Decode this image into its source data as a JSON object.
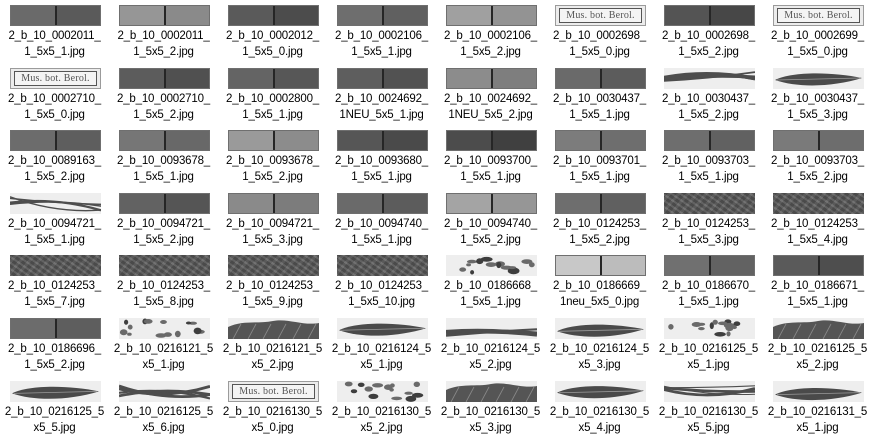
{
  "files": [
    {
      "line1": "2_b_10_0002011_",
      "line2": "1_5x5_1.jpg",
      "thumb": "bar",
      "left": "#6a6a6a",
      "right": "#5a5a5a"
    },
    {
      "line1": "2_b_10_0002011_",
      "line2": "1_5x5_2.jpg",
      "thumb": "bar",
      "left": "#969696",
      "right": "#8a8a8a"
    },
    {
      "line1": "2_b_10_0002012_",
      "line2": "1_5x5_0.jpg",
      "thumb": "bar",
      "left": "#5a5a5a",
      "right": "#4c4c4c"
    },
    {
      "line1": "2_b_10_0002106_",
      "line2": "1_5x5_1.jpg",
      "thumb": "bar",
      "left": "#6e6e6e",
      "right": "#606060"
    },
    {
      "line1": "2_b_10_0002106_",
      "line2": "1_5x5_2.jpg",
      "thumb": "bar",
      "left": "#a0a0a0",
      "right": "#939393"
    },
    {
      "line1": "2_b_10_0002698_",
      "line2": "1_5x5_0.jpg",
      "thumb": "label",
      "label_text": "Mus. bot. Berol."
    },
    {
      "line1": "2_b_10_0002698_",
      "line2": "1_5x5_2.jpg",
      "thumb": "bar",
      "left": "#545454",
      "right": "#474747"
    },
    {
      "line1": "2_b_10_0002699_",
      "line2": "1_5x5_0.jpg",
      "thumb": "label",
      "label_text": "Mus. bot. Berol."
    },
    {
      "line1": "2_b_10_0002710_",
      "line2": "1_5x5_0.jpg",
      "thumb": "label",
      "label_text": "Mus. bot. Berol."
    },
    {
      "line1": "2_b_10_0002710_",
      "line2": "1_5x5_2.jpg",
      "thumb": "bar",
      "left": "#5c5c5c",
      "right": "#505050"
    },
    {
      "line1": "2_b_10_0002800_",
      "line2": "1_5x5_1.jpg",
      "thumb": "bar",
      "left": "#646464",
      "right": "#575757"
    },
    {
      "line1": "2_b_10_0024692_",
      "line2": "1NEU_5x5_1.jpg",
      "thumb": "bar",
      "left": "#5e5e5e",
      "right": "#525252"
    },
    {
      "line1": "2_b_10_0024692_",
      "line2": "1NEU_5x5_2.jpg",
      "thumb": "bar",
      "left": "#8c8c8c",
      "right": "#7e7e7e"
    },
    {
      "line1": "2_b_10_0030437_",
      "line2": "1_5x5_1.jpg",
      "thumb": "bar",
      "left": "#6a6a6a",
      "right": "#5c5c5c"
    },
    {
      "line1": "2_b_10_0030437_",
      "line2": "1_5x5_2.jpg",
      "thumb": "plant"
    },
    {
      "line1": "2_b_10_0030437_",
      "line2": "1_5x5_3.jpg",
      "thumb": "plant"
    },
    {
      "line1": "2_b_10_0089163_",
      "line2": "1_5x5_2.jpg",
      "thumb": "bar",
      "left": "#6c6c6c",
      "right": "#5e5e5e"
    },
    {
      "line1": "2_b_10_0093678_",
      "line2": "1_5x5_1.jpg",
      "thumb": "bar",
      "left": "#767676",
      "right": "#686868"
    },
    {
      "line1": "2_b_10_0093678_",
      "line2": "1_5x5_2.jpg",
      "thumb": "bar",
      "left": "#9a9a9a",
      "right": "#8c8c8c"
    },
    {
      "line1": "2_b_10_0093680_",
      "line2": "1_5x5_1.jpg",
      "thumb": "bar",
      "left": "#565656",
      "right": "#4a4a4a"
    },
    {
      "line1": "2_b_10_0093700_",
      "line2": "1_5x5_1.jpg",
      "thumb": "bar",
      "left": "#4c4c4c",
      "right": "#404040"
    },
    {
      "line1": "2_b_10_0093701_",
      "line2": "1_5x5_1.jpg",
      "thumb": "bar",
      "left": "#7c7c7c",
      "right": "#6e6e6e"
    },
    {
      "line1": "2_b_10_0093703_",
      "line2": "1_5x5_1.jpg",
      "thumb": "bar",
      "left": "#6e6e6e",
      "right": "#616161"
    },
    {
      "line1": "2_b_10_0093703_",
      "line2": "1_5x5_2.jpg",
      "thumb": "bar",
      "left": "#7a7a7a",
      "right": "#6d6d6d"
    },
    {
      "line1": "2_b_10_0094721_",
      "line2": "1_5x5_1.jpg",
      "thumb": "plant"
    },
    {
      "line1": "2_b_10_0094721_",
      "line2": "1_5x5_2.jpg",
      "thumb": "bar",
      "left": "#626262",
      "right": "#555555"
    },
    {
      "line1": "2_b_10_0094721_",
      "line2": "1_5x5_3.jpg",
      "thumb": "bar",
      "left": "#8a8a8a",
      "right": "#7c7c7c"
    },
    {
      "line1": "2_b_10_0094740_",
      "line2": "1_5x5_1.jpg",
      "thumb": "bar",
      "left": "#6a6a6a",
      "right": "#5c5c5c"
    },
    {
      "line1": "2_b_10_0094740_",
      "line2": "1_5x5_2.jpg",
      "thumb": "bar",
      "left": "#a4a4a4",
      "right": "#969696"
    },
    {
      "line1": "2_b_10_0124253_",
      "line2": "1_5x5_2.jpg",
      "thumb": "bar",
      "left": "#6e6e6e",
      "right": "#606060"
    },
    {
      "line1": "2_b_10_0124253_",
      "line2": "1_5x5_3.jpg",
      "thumb": "texture"
    },
    {
      "line1": "2_b_10_0124253_",
      "line2": "1_5x5_4.jpg",
      "thumb": "texture"
    },
    {
      "line1": "2_b_10_0124253_",
      "line2": "1_5x5_7.jpg",
      "thumb": "texture"
    },
    {
      "line1": "2_b_10_0124253_",
      "line2": "1_5x5_8.jpg",
      "thumb": "texture"
    },
    {
      "line1": "2_b_10_0124253_",
      "line2": "1_5x5_9.jpg",
      "thumb": "texture"
    },
    {
      "line1": "2_b_10_0124253_",
      "line2": "1_5x5_10.jpg",
      "thumb": "texture"
    },
    {
      "line1": "2_b_10_0186668_",
      "line2": "1_5x5_1.jpg",
      "thumb": "plant"
    },
    {
      "line1": "2_b_10_0186669_",
      "line2": "1neu_5x5_0.jpg",
      "thumb": "bar",
      "left": "#c8c8c8",
      "right": "#bcbcbc"
    },
    {
      "line1": "2_b_10_0186670_",
      "line2": "1_5x5_1.jpg",
      "thumb": "bar",
      "left": "#707070",
      "right": "#626262"
    },
    {
      "line1": "2_b_10_0186671_",
      "line2": "1_5x5_1.jpg",
      "thumb": "bar",
      "left": "#5a5a5a",
      "right": "#4e4e4e"
    },
    {
      "line1": "2_b_10_0186696_",
      "line2": "1_5x5_2.jpg",
      "thumb": "bar",
      "left": "#6c6c6c",
      "right": "#5e5e5e"
    },
    {
      "line1": "2_b_10_0216121_5",
      "line2": "x5_1.jpg",
      "thumb": "plant"
    },
    {
      "line1": "2_b_10_0216121_5",
      "line2": "x5_2.jpg",
      "thumb": "plant"
    },
    {
      "line1": "2_b_10_0216124_5",
      "line2": "x5_1.jpg",
      "thumb": "plant"
    },
    {
      "line1": "2_b_10_0216124_5",
      "line2": "x5_2.jpg",
      "thumb": "plant"
    },
    {
      "line1": "2_b_10_0216124_5",
      "line2": "x5_3.jpg",
      "thumb": "plant"
    },
    {
      "line1": "2_b_10_0216125_5",
      "line2": "x5_1.jpg",
      "thumb": "plant"
    },
    {
      "line1": "2_b_10_0216125_5",
      "line2": "x5_2.jpg",
      "thumb": "plant"
    },
    {
      "line1": "2_b_10_0216125_5",
      "line2": "x5_5.jpg",
      "thumb": "plant"
    },
    {
      "line1": "2_b_10_0216125_5",
      "line2": "x5_6.jpg",
      "thumb": "plant"
    },
    {
      "line1": "2_b_10_0216130_5",
      "line2": "x5_0.jpg",
      "thumb": "label",
      "label_text": "Mus. bot. Berol."
    },
    {
      "line1": "2_b_10_0216130_5",
      "line2": "x5_2.jpg",
      "thumb": "plant"
    },
    {
      "line1": "2_b_10_0216130_5",
      "line2": "x5_3.jpg",
      "thumb": "plant"
    },
    {
      "line1": "2_b_10_0216130_5",
      "line2": "x5_4.jpg",
      "thumb": "plant"
    },
    {
      "line1": "2_b_10_0216130_5",
      "line2": "x5_5.jpg",
      "thumb": "plant"
    },
    {
      "line1": "2_b_10_0216131_5",
      "line2": "x5_1.jpg",
      "thumb": "plant"
    }
  ]
}
